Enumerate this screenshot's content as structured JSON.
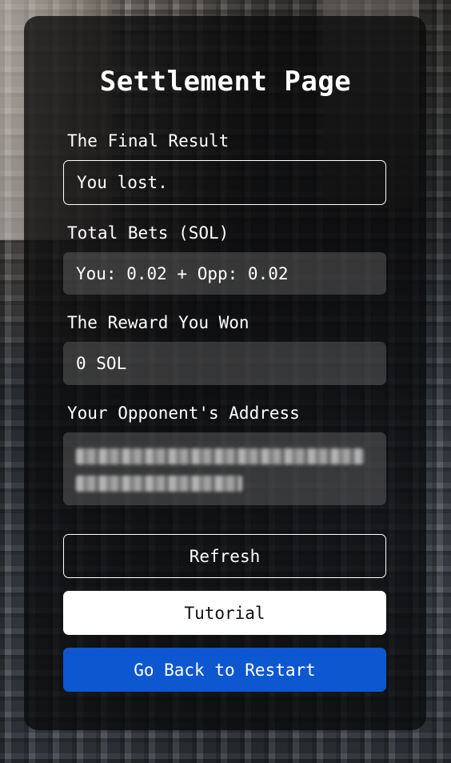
{
  "page": {
    "title": "Settlement Page"
  },
  "final_result": {
    "label": "The Final Result",
    "value": "You lost."
  },
  "total_bets": {
    "label": "Total Bets (SOL)",
    "value": "You: 0.02 + Opp: 0.02"
  },
  "reward": {
    "label": "The Reward You Won",
    "value": "0 SOL"
  },
  "opponent": {
    "label": "Your Opponent's Address",
    "value_redacted": true
  },
  "buttons": {
    "refresh": "Refresh",
    "tutorial": "Tutorial",
    "restart": "Go Back to Restart"
  },
  "colors": {
    "primary_button": "#0d57d0",
    "card_background": "rgba(10,10,12,0.78)",
    "text": "#ffffff"
  }
}
